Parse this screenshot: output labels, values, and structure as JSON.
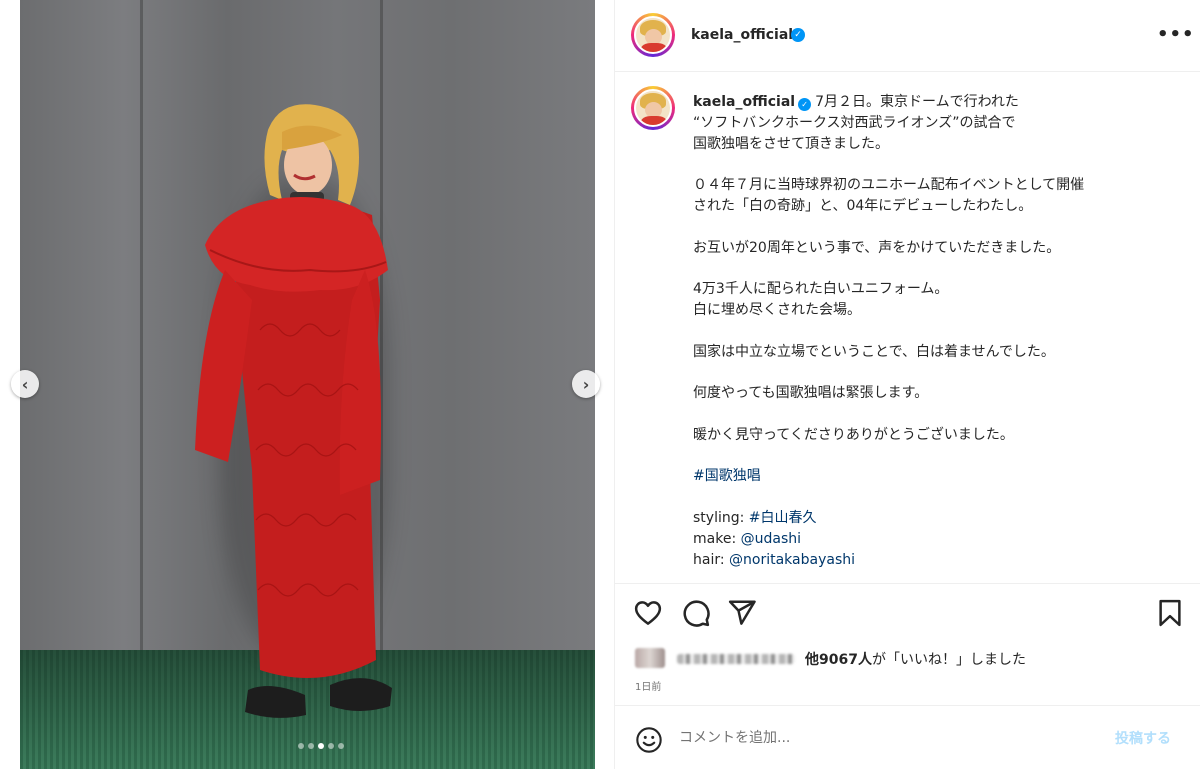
{
  "post": {
    "username": "kaela_official",
    "verified_glyph": "✓",
    "more_glyph": "•••"
  },
  "media": {
    "prev_glyph": "‹",
    "next_glyph": "›",
    "slide_count": 5,
    "active_slide": 3
  },
  "caption": {
    "username": "kaela_official",
    "first_line": "7月２日。東京ドームで行われた",
    "lines": [
      "“ソフトバンクホークス対西武ライオンズ”の試合で",
      "国歌独唱をさせて頂きました。",
      "",
      "０４年７月に当時球界初のユニホーム配布イベントとして開催",
      "された「白の奇跡」と、04年にデビューしたわたし。",
      "",
      "お互いが20周年という事で、声をかけていただきました。",
      "",
      "4万3千人に配られた白いユニフォーム。",
      "白に埋め尽くされた会場。",
      "",
      "国家は中立な立場でということで、白は着ませんでした。",
      "",
      "何度やっても国歌独唱は緊張します。",
      "",
      "暖かく見守ってくださりありがとうございました。",
      ""
    ],
    "hashtag": "#国歌独唱",
    "credits": {
      "styling_label": "styling: ",
      "styling_value": "#白山春久",
      "make_label": "make: ",
      "make_value": "@udashi",
      "hair_label": "hair: ",
      "hair_value": "@noritakabayashi"
    }
  },
  "actions": {
    "like_icon": "heart-icon",
    "comment_icon": "comment-icon",
    "share_icon": "paper-plane-icon",
    "save_icon": "bookmark-icon"
  },
  "likes": {
    "count_text": "他9067人",
    "suffix_text": "が「いいね！」しました",
    "time": "1日前"
  },
  "comment": {
    "placeholder": "コメントを追加...",
    "post_label": "投稿する"
  },
  "colors": {
    "accent": "#0095f6",
    "link": "#00376b",
    "dress": "#c41e1e",
    "hair": "#e1b24d"
  }
}
